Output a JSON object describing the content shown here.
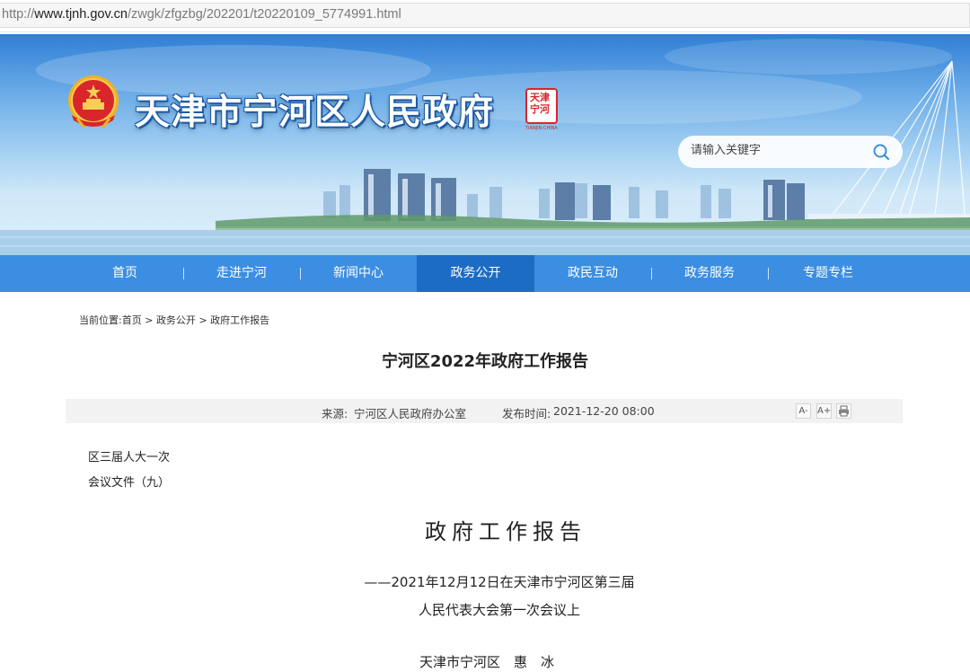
{
  "browser": {
    "url_prefix": "http://",
    "url_domain": "www.tjnh.gov.cn",
    "url_path": "/zwgk/zfgzbg/202201/t20220109_5774991.html"
  },
  "header": {
    "site_title": "天津市宁河区人民政府",
    "seal_text": "天津宁河",
    "seal_caption": "TIANJIN·CHINA",
    "search_placeholder": "请输入关键字"
  },
  "nav": {
    "items": [
      {
        "label": "首页"
      },
      {
        "label": "走进宁河"
      },
      {
        "label": "新闻中心"
      },
      {
        "label": "政务公开",
        "active": true
      },
      {
        "label": "政民互动"
      },
      {
        "label": "政务服务"
      },
      {
        "label": "专题专栏"
      }
    ]
  },
  "breadcrumb": {
    "prefix": "当前位置:",
    "items": [
      "首页",
      "政务公开",
      "政府工作报告"
    ],
    "separator": ">"
  },
  "article": {
    "title": "宁河区2022年政府工作报告",
    "source_label": "来源:",
    "source_value": "宁河区人民政府办公室",
    "time_label": "发布时间:",
    "time_value": "2021-12-20 08:00",
    "tools": [
      "A-",
      "A+",
      "print"
    ],
    "doc_label_line1": "区三届人大一次",
    "doc_label_line2": "会议文件（九）",
    "heading": "政府工作报告",
    "subtitle_line1": "——2021年12月12日在天津市宁河区第三届",
    "subtitle_line2": "人民代表大会第一次会议上",
    "author_place": "天津市宁河区",
    "author_name": "惠　冰"
  },
  "colors": {
    "nav_bg": "#3b8ee2",
    "nav_active": "#1d6cc3",
    "meta_bg": "#f2f2f2",
    "seal_red": "#d8262b"
  }
}
